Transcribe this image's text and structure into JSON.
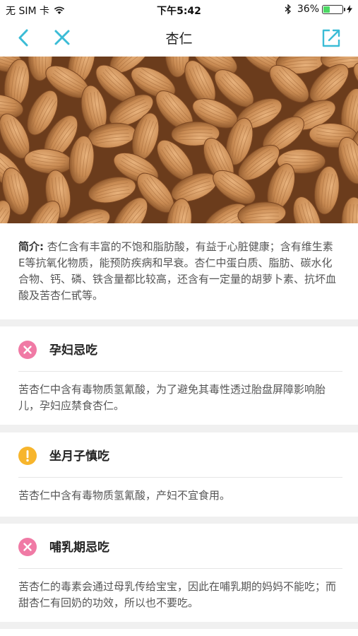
{
  "status": {
    "carrier": "无 SIM 卡",
    "time": "下午5:42",
    "battery_text": "36%",
    "battery_level": 0.36
  },
  "nav": {
    "title": "杏仁"
  },
  "intro": {
    "label": "简介:",
    "text": " 杏仁含有丰富的不饱和脂肪酸，有益于心脏健康；含有维生素E等抗氧化物质，能预防疾病和早衰。杏仁中蛋白质、脂肪、碳水化合物、钙、磷、铁含量都比较高，还含有一定量的胡萝卜素、抗坏血酸及苦杏仁甙等。"
  },
  "cards": [
    {
      "title": "孕妇忌吃",
      "icon": "cross-icon",
      "color": "#f07aa5",
      "text": "苦杏仁中含有毒物质氢氰酸，为了避免其毒性透过胎盘屏障影响胎儿，孕妇应禁食杏仁。"
    },
    {
      "title": "坐月子慎吃",
      "icon": "exclamation-icon",
      "color": "#f7b52c",
      "text": "苦杏仁中含有毒物质氢氰酸，产妇不宜食用。"
    },
    {
      "title": "哺乳期忌吃",
      "icon": "cross-icon",
      "color": "#f07aa5",
      "text": "苦杏仁的毒素会通过母乳传给宝宝，因此在哺乳期的妈妈不能吃；而甜杏仁有回奶的功效，所以也不要吃。"
    }
  ],
  "colors": {
    "accent": "#3bbcd6",
    "page_bg": "#f0f0f0"
  }
}
